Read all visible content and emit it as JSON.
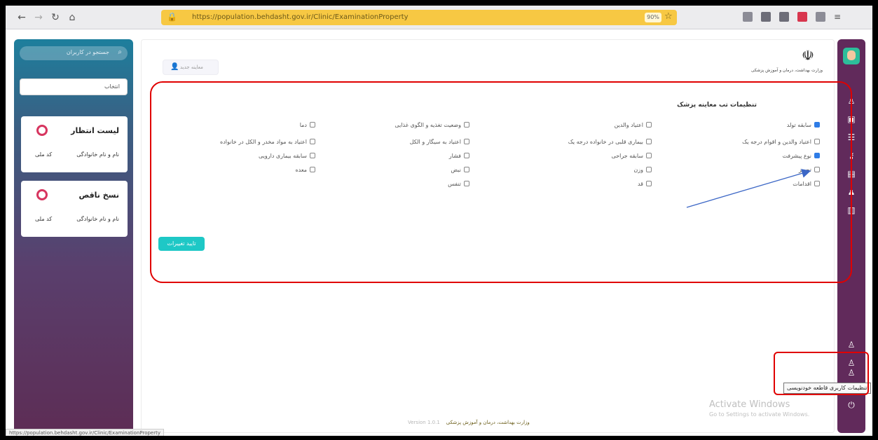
{
  "browser": {
    "url": "https://population.behdasht.gov.ir/Clinic/ExaminationProperty",
    "zoom": "90%"
  },
  "left_panel": {
    "search_placeholder": "جستجو در کاربران",
    "select_value": "انتخاب",
    "cards": [
      {
        "title": "لیست انتظار",
        "field1": "نام و نام خانوادگی",
        "field2": "کد ملی"
      },
      {
        "title": "نسخ ناقص",
        "field1": "نام و نام خانوادگی",
        "field2": "کد ملی"
      }
    ]
  },
  "main": {
    "top_button": "معاینه جدید",
    "emblem_text": "وزارت بهداشت، درمان و آموزش پزشکی",
    "section_title": "تنظیمات تب معاینه پزشک",
    "checkbox_columns": [
      [
        {
          "label": "سابقه تولد",
          "checked": true
        },
        {
          "label": "اعتیاد والدین و اقوام درجه یک",
          "checked": false
        },
        {
          "label": "نوع پیشرفت",
          "checked": true
        },
        {
          "label": "تجویز",
          "checked": false
        },
        {
          "label": "اقدامات",
          "checked": false
        }
      ],
      [
        {
          "label": "اعتیاد والدین",
          "checked": false
        },
        {
          "label": "بیماری قلبی در خانواده درجه یک",
          "checked": false
        },
        {
          "label": "سابقه جراحی",
          "checked": false
        },
        {
          "label": "وزن",
          "checked": false
        },
        {
          "label": "قد",
          "checked": false
        }
      ],
      [
        {
          "label": "وضعیت تغذیه و الگوی غذایی",
          "checked": false
        },
        {
          "label": "اعتیاد به سیگار و الکل",
          "checked": false
        },
        {
          "label": "فشار",
          "checked": false
        },
        {
          "label": "نبض",
          "checked": false
        },
        {
          "label": "تنفس",
          "checked": false
        }
      ],
      [
        {
          "label": "دما",
          "checked": false
        },
        {
          "label": "اعتیاد به مواد مخدر و الکل در خانواده",
          "checked": false
        },
        {
          "label": "سابقه بیماری دارویی",
          "checked": false
        },
        {
          "label": "معده",
          "checked": false
        }
      ]
    ],
    "confirm_button": "تایید تغییرات",
    "footer_text": "وزارت بهداشت، درمان و آموزش پزشکی",
    "footer_version": "Version 1.0.1"
  },
  "tooltip": "تنظیمات کاربری قاطعه خودنویسی",
  "watermark": {
    "line1": "Activate Windows",
    "line2": "Go to Settings to activate Windows."
  },
  "status_url": "https://population.behdasht.gov.ir/Clinic/ExaminationProperty",
  "colors": {
    "rail": "#612a5b",
    "accent": "#1ec8c6",
    "checked": "#2f7ce6",
    "annotation": "#e00000",
    "arrow": "#3c67c6"
  }
}
